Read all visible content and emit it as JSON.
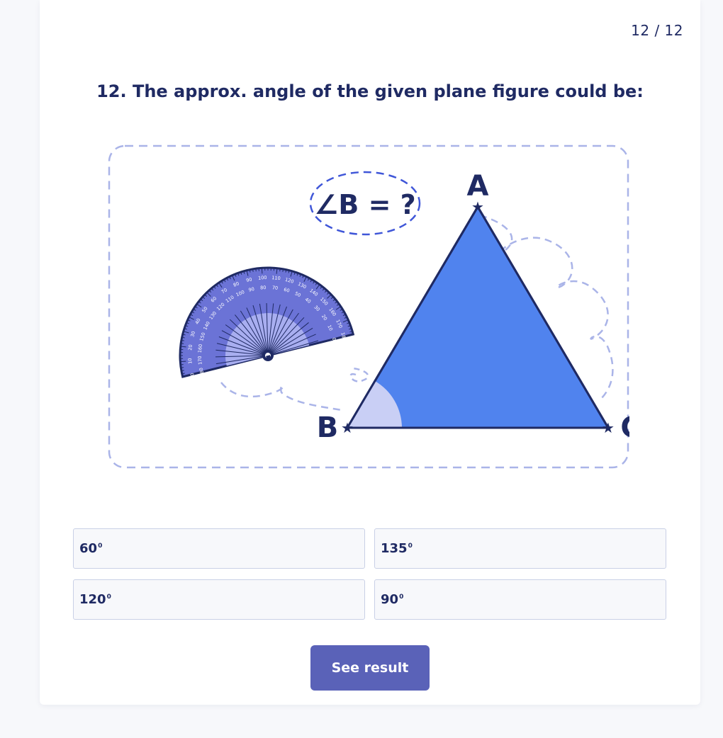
{
  "header": {
    "progress": "12 / 12"
  },
  "question": {
    "text": "12. The approx. angle of the given plane figure could be:"
  },
  "figure": {
    "angle_prompt": "∠B = ?",
    "vertex_a": "A",
    "vertex_b": "B",
    "vertex_c": "C",
    "protractor_outer_labels": [
      "0",
      "10",
      "20",
      "30",
      "40",
      "50",
      "60",
      "70",
      "80",
      "90",
      "100",
      "110",
      "120",
      "130",
      "140",
      "150",
      "160",
      "170",
      "180"
    ],
    "protractor_inner_labels": [
      "180",
      "170",
      "160",
      "150",
      "140",
      "130",
      "120",
      "110",
      "100",
      "90",
      "80",
      "70",
      "60",
      "50",
      "40",
      "30",
      "20",
      "10",
      "0"
    ],
    "colors": {
      "triangle_fill": "#5083ee",
      "triangle_stroke": "#1f2a63",
      "angle_fill": "#c9cff5",
      "protractor": "#6b73d6",
      "dash": "#aab4e8"
    }
  },
  "options": [
    {
      "value": "60",
      "unit": "0"
    },
    {
      "value": "135",
      "unit": "0"
    },
    {
      "value": "120",
      "unit": "0"
    },
    {
      "value": "90",
      "unit": "0"
    }
  ],
  "actions": {
    "submit_label": "See result"
  },
  "theme": {
    "button_color": "#5a62b8",
    "text_color": "#1f2a63"
  }
}
